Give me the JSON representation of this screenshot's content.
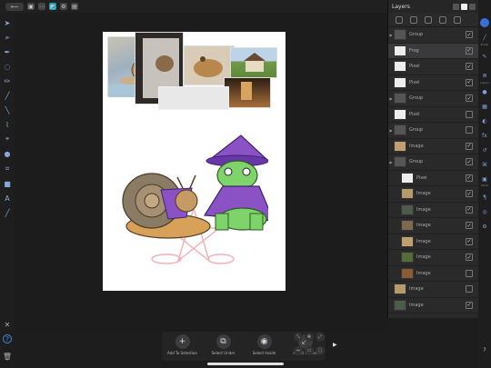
{
  "topbar": {
    "back_icon": "back-arrow",
    "icons": [
      "document-icon",
      "more-icon",
      "persona-icon",
      "settings-icon",
      "export-icon"
    ]
  },
  "left_tools": [
    "move-tool",
    "node-tool",
    "pen-tool",
    "brush-tool",
    "pencil-tool",
    "paint-brush-tool",
    "eyedropper-tool",
    "fill-tool",
    "color-picker-tool",
    "crop-tool",
    "shape-tool",
    "text-tool",
    "vector-crop-tool"
  ],
  "layers_panel": {
    "title": "Layers",
    "items": [
      {
        "name": "Group",
        "type": "group",
        "checked": true
      },
      {
        "name": "Frog",
        "type": "pixel",
        "checked": true,
        "selected": true
      },
      {
        "name": "Pixel",
        "type": "pixel",
        "checked": true
      },
      {
        "name": "Pixel",
        "type": "pixel",
        "checked": true
      },
      {
        "name": "Group",
        "type": "group",
        "checked": true
      },
      {
        "name": "Pixel",
        "type": "pixel",
        "checked": false
      },
      {
        "name": "Group",
        "type": "group",
        "checked": false
      },
      {
        "name": "Image",
        "type": "image",
        "checked": true
      },
      {
        "name": "Group",
        "type": "group",
        "checked": true
      },
      {
        "name": "Pixel",
        "type": "pixel",
        "checked": true
      },
      {
        "name": "Image",
        "type": "image",
        "checked": true
      },
      {
        "name": "Image",
        "type": "image",
        "checked": true
      },
      {
        "name": "Image",
        "type": "image",
        "checked": true
      },
      {
        "name": "Image",
        "type": "image",
        "checked": true
      },
      {
        "name": "Image",
        "type": "image",
        "checked": true
      },
      {
        "name": "Image",
        "type": "image",
        "checked": false
      },
      {
        "name": "Image",
        "type": "image",
        "checked": false
      },
      {
        "name": "Image",
        "type": "image",
        "checked": true
      }
    ]
  },
  "right_strip": {
    "labels": [
      "Brush",
      "Color",
      "Layers",
      "Swatches",
      "Stock"
    ]
  },
  "context_toolbar": {
    "buttons": [
      {
        "label": "Add To Selection",
        "icon": "plus-icon"
      },
      {
        "label": "Select Under",
        "icon": "select-under-icon"
      },
      {
        "label": "Select Inside",
        "icon": "select-inside-icon"
      },
      {
        "label": "About Centre",
        "icon": "about-centre-icon"
      }
    ]
  },
  "colors": {
    "accent": "#1c9fb0",
    "panel": "#2a2a2b",
    "canvas_bg": "#1c1c1d",
    "doc_bg": "#ffffff"
  }
}
